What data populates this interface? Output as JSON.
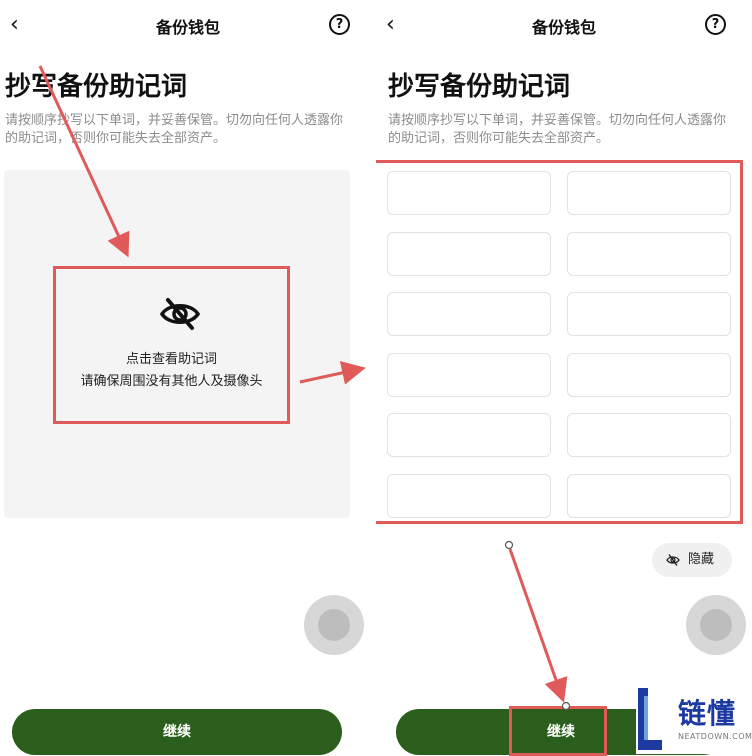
{
  "left_screen": {
    "nav_title": "备份钱包",
    "back_icon": "chevron-left-icon",
    "help_icon": "help-circle-icon",
    "help_glyph": "?",
    "page_title": "抄写备份助记词",
    "description": "请按顺序抄写以下单词，并妥善保管。切勿向任何人透露你的助记词，否则你可能失去全部资产。",
    "reveal": {
      "icon": "eye-off-icon",
      "line1": "点击查看助记词",
      "line2": "请确保周围没有其他人及摄像头"
    },
    "continue_label": "继续"
  },
  "right_screen": {
    "nav_title": "备份钱包",
    "back_icon": "chevron-left-icon",
    "help_icon": "help-circle-icon",
    "help_glyph": "?",
    "page_title": "抄写备份助记词",
    "description": "请按顺序抄写以下单词，并妥善保管。切勿向任何人透露你的助记词，否则你可能失去全部资产。",
    "word_cells": 12,
    "hide_label": "隐藏",
    "continue_label": "继续"
  },
  "watermark": {
    "text": "链懂",
    "sub": "NEATDOWN.COM",
    "brand_color": "#1c3aa0"
  },
  "colors": {
    "accent_green": "#2b5e1c",
    "annotation_red": "#e05a5a"
  }
}
